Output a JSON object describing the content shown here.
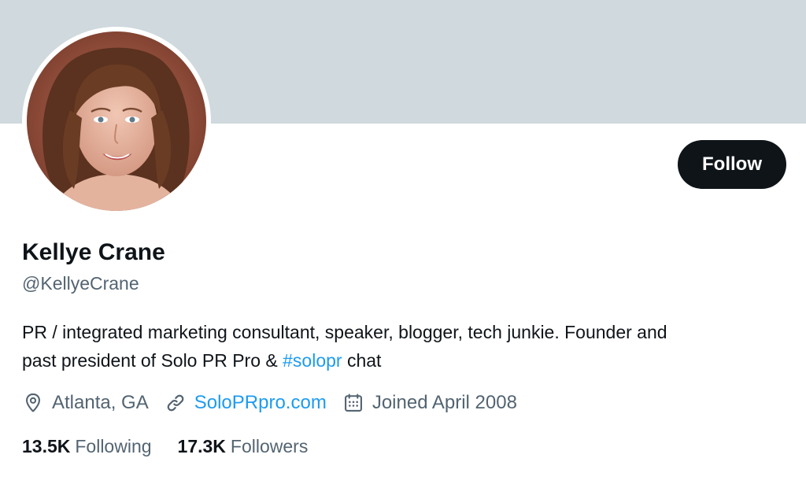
{
  "profile": {
    "display_name": "Kellye Crane",
    "handle": "@KellyeCrane",
    "avatar_icon": "profile-photo",
    "bio": {
      "line1": "PR / integrated marketing consultant, speaker, blogger, tech junkie. Founder and",
      "line2_prefix": "past president of Solo PR Pro & ",
      "hashtag": "#solopr",
      "line2_suffix": " chat"
    },
    "location": {
      "icon": "location-pin-icon",
      "text": "Atlanta, GA"
    },
    "website": {
      "icon": "link-icon",
      "text": "SoloPRpro.com"
    },
    "joined": {
      "icon": "calendar-icon",
      "text": "Joined April 2008"
    },
    "following": {
      "count": "13.5K",
      "label": "Following"
    },
    "followers": {
      "count": "17.3K",
      "label": "Followers"
    }
  },
  "actions": {
    "follow_label": "Follow"
  },
  "colors": {
    "banner": "#cfd9de",
    "text_primary": "#0f1419",
    "text_secondary": "#536471",
    "link": "#1d9bf0",
    "button_bg": "#0f1419"
  }
}
